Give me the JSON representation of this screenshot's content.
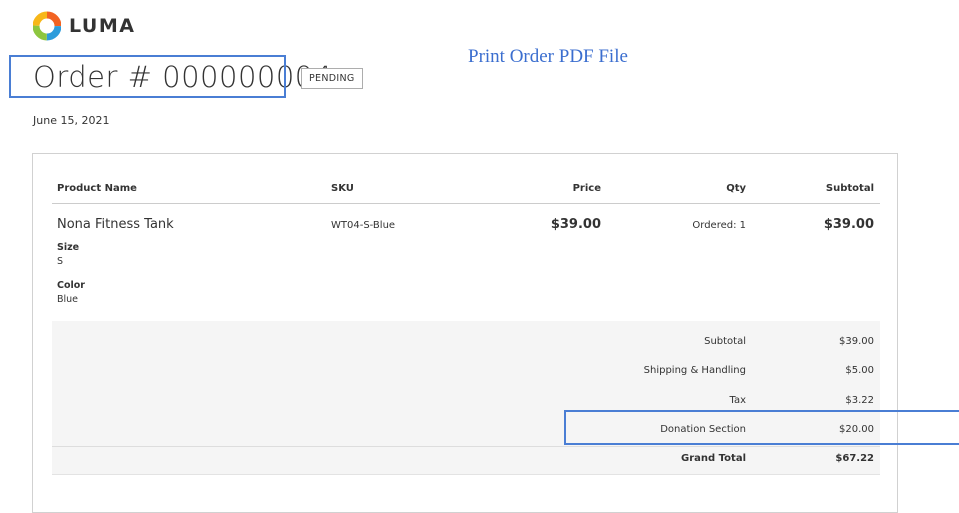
{
  "brand": {
    "name": "LUMA"
  },
  "annotation": {
    "print_link": "Print Order PDF File"
  },
  "order": {
    "title": "Order # 000000004",
    "status": "PENDING",
    "date": "June 15, 2021"
  },
  "table": {
    "headers": {
      "product_name": "Product Name",
      "sku": "SKU",
      "price": "Price",
      "qty": "Qty",
      "subtotal": "Subtotal"
    },
    "item": {
      "name": "Nona Fitness Tank",
      "sku": "WT04-S-Blue",
      "price": "$39.00",
      "qty": "Ordered: 1",
      "subtotal": "$39.00",
      "options": [
        {
          "label": "Size",
          "value": "S"
        },
        {
          "label": "Color",
          "value": "Blue"
        }
      ]
    }
  },
  "totals": [
    {
      "label": "Subtotal",
      "value": "$39.00"
    },
    {
      "label": "Shipping & Handling",
      "value": "$5.00"
    },
    {
      "label": "Tax",
      "value": "$3.22"
    },
    {
      "label": "Donation Section",
      "value": "$20.00"
    },
    {
      "label": "Grand Total",
      "value": "$67.22"
    }
  ],
  "colors": {
    "highlight": "#4a7ed4",
    "link": "#3b6ecf",
    "totals_bg": "#f5f5f5",
    "logo_orange": "#f26322",
    "logo_blue": "#2d9cdb",
    "logo_green": "#8dc63f",
    "logo_yellow": "#f7b719"
  }
}
